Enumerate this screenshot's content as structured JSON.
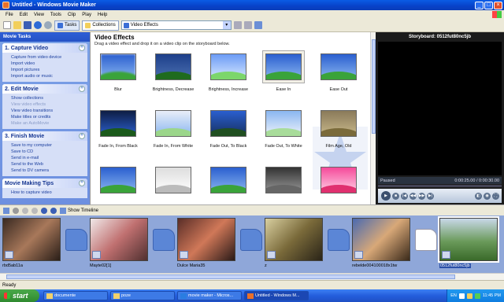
{
  "window": {
    "title": "Untitled - Windows Movie Maker"
  },
  "menu": [
    "File",
    "Edit",
    "View",
    "Tools",
    "Clip",
    "Play",
    "Help"
  ],
  "toolbar": {
    "tasks_label": "Tasks",
    "collections_label": "Collections",
    "dropdown_value": "Video Effects"
  },
  "tasks_pane": {
    "header": "Movie Tasks",
    "sections": [
      {
        "title": "1. Capture Video",
        "items": [
          "Capture from video device",
          "Import video",
          "Import pictures",
          "Import audio or music"
        ]
      },
      {
        "title": "2. Edit Movie",
        "items": [
          "Show collections",
          "View video effects",
          "View video transitions",
          "Make titles or credits",
          "Make an AutoMovie"
        ]
      },
      {
        "title": "3. Finish Movie",
        "items": [
          "Save to my computer",
          "Save to CD",
          "Send in e-mail",
          "Send to the Web",
          "Send to DV camera"
        ]
      },
      {
        "title": "Movie Making Tips",
        "items": [
          "How to capture video"
        ]
      }
    ]
  },
  "main": {
    "title": "Video Effects",
    "subtitle": "Drag a video effect and drop it on a video clip on the storyboard below.",
    "effects": [
      "Blur",
      "Brightness, Decrease",
      "Brightness, Increase",
      "Ease In",
      "Ease Out",
      "Fade In, From Black",
      "Fade In, From White",
      "Fade Out, To Black",
      "Fade Out, To White",
      "Film Age, Old",
      "",
      "",
      "",
      "",
      ""
    ],
    "selected_effect": "Ease In"
  },
  "preview": {
    "title": "Storyboard: 0512fut80nc5jb",
    "status": "Paused",
    "time": "0:00:25.00 / 0:00:30.00"
  },
  "storyboard_toolbar": {
    "show_timeline_label": "Show Timeline"
  },
  "storyboard": {
    "clips": [
      "rbd5ab11a",
      "Mayte02[1]",
      "Dulce Maria35",
      "z",
      "rebelde004100018x1tw",
      "0512fut80nc5jb"
    ],
    "selected_clip": "0512fut80nc5jb"
  },
  "status_bar": {
    "text": "Ready"
  },
  "taskbar": {
    "start_label": "start",
    "items": [
      "documente",
      "poze",
      "movie maker - Micros...",
      "Untitled - Windows M..."
    ],
    "language": "EN",
    "clock": "11:45 PM"
  }
}
